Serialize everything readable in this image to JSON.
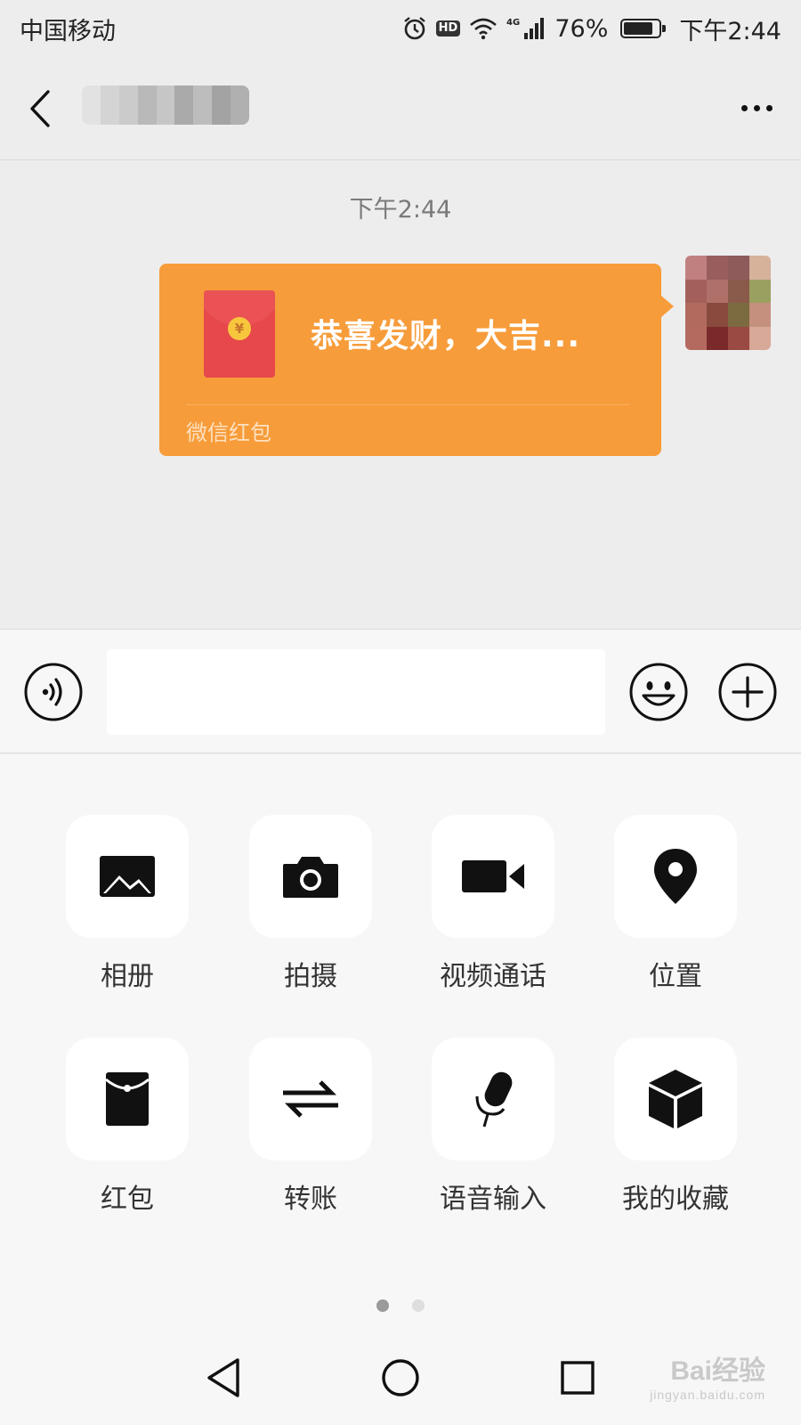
{
  "status_bar": {
    "carrier": "中国移动",
    "network": "4G",
    "battery_percent": "76%",
    "battery_level": 0.76,
    "time": "下午2:44",
    "icons": [
      "alarm-icon",
      "hd-icon",
      "wifi-icon",
      "signal-icon",
      "battery-icon"
    ]
  },
  "header": {
    "back_icon": "chevron-left-icon",
    "contact_name_pixelated": true,
    "more_icon": "more-dots-icon"
  },
  "chat": {
    "timestamp": "下午2:44",
    "messages": [
      {
        "type": "red-packet",
        "sender": "self",
        "title": "恭喜发财，大吉...",
        "footer": "微信红包",
        "coin_symbol": "¥",
        "bubble_color": "#f79c3a",
        "envelope_color": "#e7484b"
      }
    ]
  },
  "input_bar": {
    "voice_icon": "voice-icon",
    "text_value": "",
    "emoji_icon": "emoji-icon",
    "plus_icon": "plus-icon"
  },
  "panel": {
    "items": [
      {
        "label": "相册",
        "icon": "photo-icon"
      },
      {
        "label": "拍摄",
        "icon": "camera-icon"
      },
      {
        "label": "视频通话",
        "icon": "video-call-icon"
      },
      {
        "label": "位置",
        "icon": "location-icon"
      },
      {
        "label": "红包",
        "icon": "red-packet-icon"
      },
      {
        "label": "转账",
        "icon": "transfer-icon"
      },
      {
        "label": "语音输入",
        "icon": "microphone-icon"
      },
      {
        "label": "我的收藏",
        "icon": "favorites-icon"
      }
    ],
    "pages": 2,
    "current_page": 1
  },
  "nav_bar": {
    "buttons": [
      "back-triangle-icon",
      "home-circle-icon",
      "recents-square-icon"
    ]
  },
  "watermark": {
    "text": "Bai经验",
    "sub": "jingyan.baidu.com"
  }
}
